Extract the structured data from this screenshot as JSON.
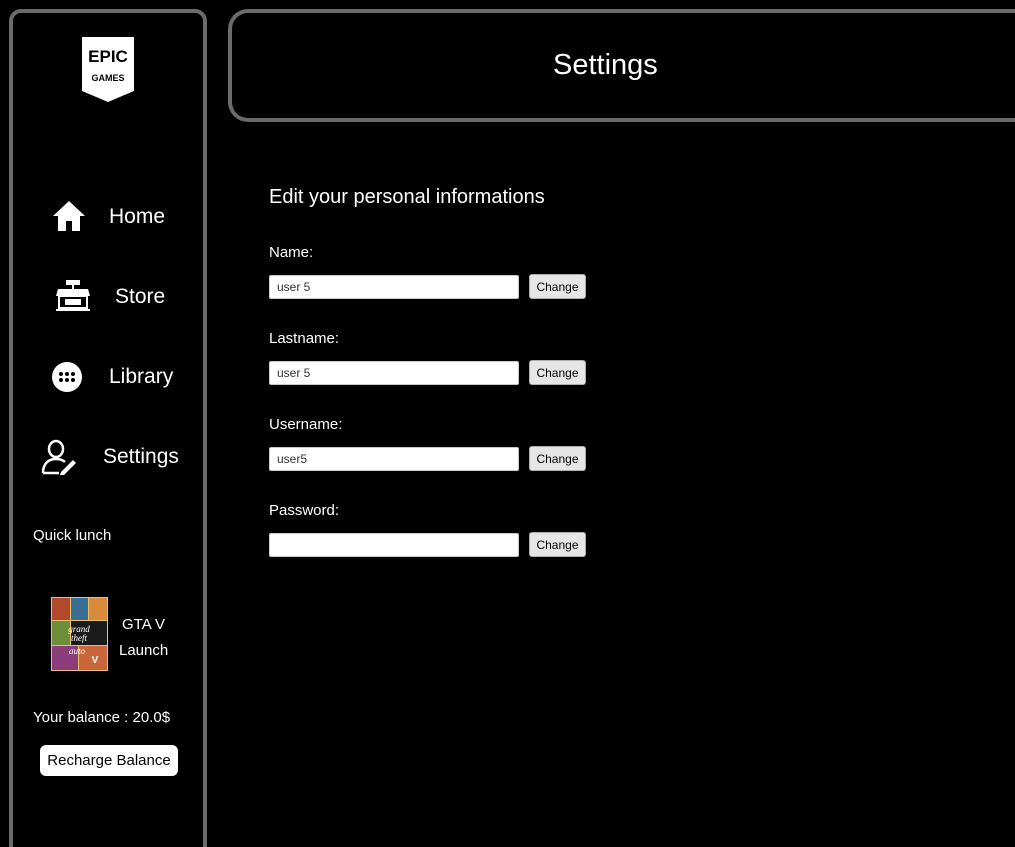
{
  "sidebar": {
    "logo": {
      "line1": "EPIC",
      "line2": "GAMES"
    },
    "nav": [
      {
        "label": "Home",
        "icon": "home-icon"
      },
      {
        "label": "Store",
        "icon": "store-icon"
      },
      {
        "label": "Library",
        "icon": "library-icon"
      },
      {
        "label": "Settings",
        "icon": "settings-user-icon"
      }
    ],
    "quick_launch_label": "Quick lunch",
    "game": {
      "title": "GTA V",
      "launch_label": "Launch"
    },
    "balance_text": "Your balance : 20.0$",
    "recharge_label": "Recharge Balance"
  },
  "header": {
    "title": "Settings"
  },
  "form": {
    "section_title": "Edit your personal informations",
    "change_label": "Change",
    "fields": [
      {
        "label": "Name:",
        "value": "user 5"
      },
      {
        "label": "Lastname:",
        "value": "user 5"
      },
      {
        "label": "Username:",
        "value": "user5"
      },
      {
        "label": "Password:",
        "value": ""
      }
    ]
  },
  "colors": {
    "background": "#000000",
    "border": "#6b6b6b",
    "text": "#ffffff"
  }
}
